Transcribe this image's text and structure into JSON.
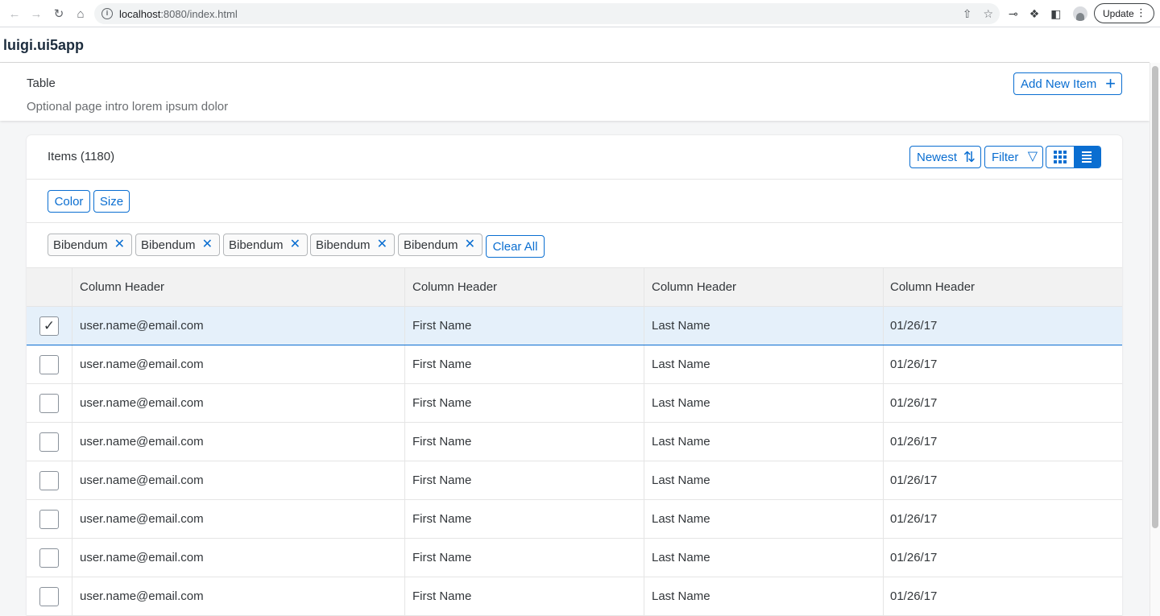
{
  "browser": {
    "url_host": "localhost",
    "url_rest": ":8080/index.html",
    "update_label": "Update"
  },
  "app": {
    "title": "luigi.ui5app"
  },
  "page": {
    "title": "Table",
    "subtitle": "Optional page intro lorem ipsum dolor",
    "add_button": "Add New Item"
  },
  "card": {
    "items_title": "Items (1180)",
    "sort_button": "Newest",
    "filter_button": "Filter",
    "filters": [
      "Color",
      "Size"
    ],
    "tokens": [
      "Bibendum",
      "Bibendum",
      "Bibendum",
      "Bibendum",
      "Bibendum"
    ],
    "clear_all": "Clear All"
  },
  "table": {
    "headers": [
      "Column Header",
      "Column Header",
      "Column Header",
      "Column Header"
    ],
    "rows": [
      {
        "email": "user.name@email.com",
        "first": "First Name",
        "last": "Last Name",
        "date": "01/26/17",
        "checked": true
      },
      {
        "email": "user.name@email.com",
        "first": "First Name",
        "last": "Last Name",
        "date": "01/26/17",
        "checked": false
      },
      {
        "email": "user.name@email.com",
        "first": "First Name",
        "last": "Last Name",
        "date": "01/26/17",
        "checked": false
      },
      {
        "email": "user.name@email.com",
        "first": "First Name",
        "last": "Last Name",
        "date": "01/26/17",
        "checked": false
      },
      {
        "email": "user.name@email.com",
        "first": "First Name",
        "last": "Last Name",
        "date": "01/26/17",
        "checked": false
      },
      {
        "email": "user.name@email.com",
        "first": "First Name",
        "last": "Last Name",
        "date": "01/26/17",
        "checked": false
      },
      {
        "email": "user.name@email.com",
        "first": "First Name",
        "last": "Last Name",
        "date": "01/26/17",
        "checked": false
      },
      {
        "email": "user.name@email.com",
        "first": "First Name",
        "last": "Last Name",
        "date": "01/26/17",
        "checked": false
      }
    ]
  },
  "colors": {
    "accent": "#0a6ed1",
    "selected_row": "#e5f0fa"
  }
}
